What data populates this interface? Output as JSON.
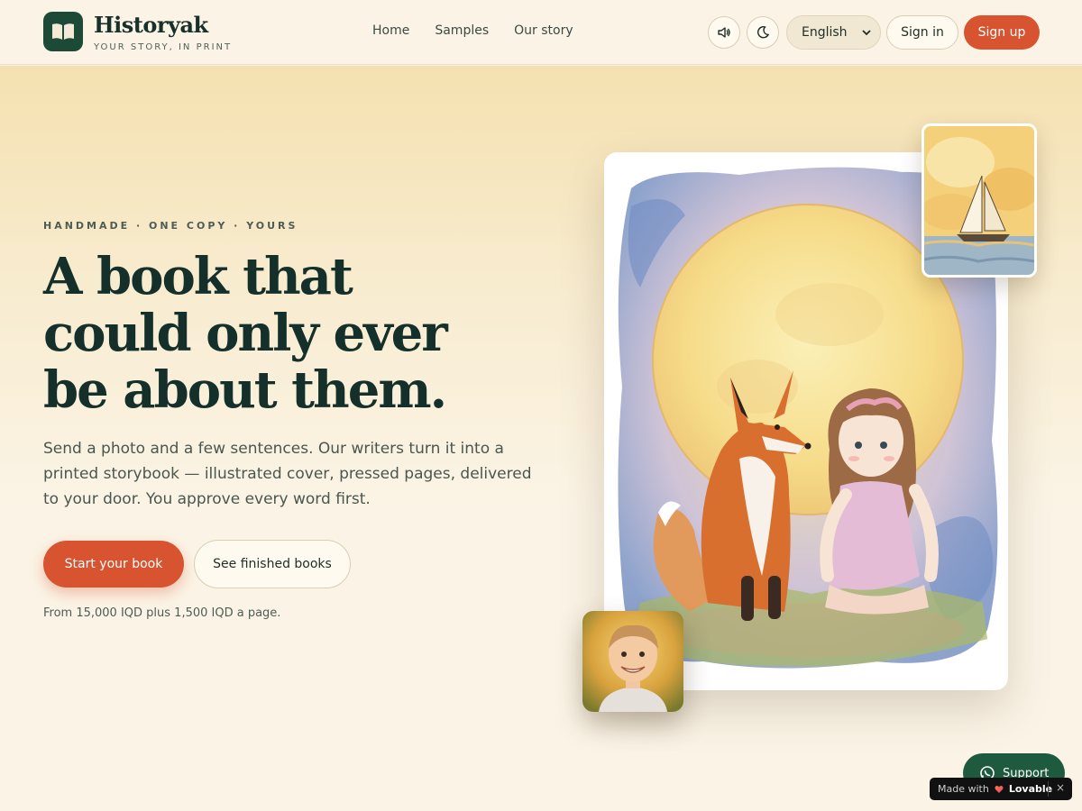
{
  "brand": {
    "name": "Historyak",
    "tagline": "YOUR STORY, IN PRINT",
    "logo_icon": "open-book-icon"
  },
  "nav": {
    "items": [
      {
        "label": "Home"
      },
      {
        "label": "Samples"
      },
      {
        "label": "Our story"
      }
    ]
  },
  "header_actions": {
    "sound_icon": "speaker-icon",
    "theme_icon": "moon-icon",
    "language": "English",
    "sign_in": "Sign in",
    "sign_up": "Sign up"
  },
  "hero": {
    "eyebrow": "HANDMADE · ONE COPY · YOURS",
    "headline_line1": "A book that",
    "headline_line2": "could only ever",
    "headline_line3": "be about them.",
    "subtext": "Send a photo and a few sentences. Our writers turn it into a printed storybook — illustrated cover, pressed pages, delivered to your door. You approve every word first.",
    "primary_cta": "Start your book",
    "secondary_cta": "See finished books",
    "price_note": "From 15,000 IQD plus 1,500 IQD a page."
  },
  "widgets": {
    "support_label": "Support",
    "support_icon": "whatsapp-icon",
    "made_with_label": "Made with",
    "made_with_brand": "Lovable",
    "close_label": "×"
  },
  "colors": {
    "accent": "#d8532f",
    "brand_green": "#1d4a36",
    "background": "#fbf4e6",
    "support_green": "#1d5a3e"
  }
}
